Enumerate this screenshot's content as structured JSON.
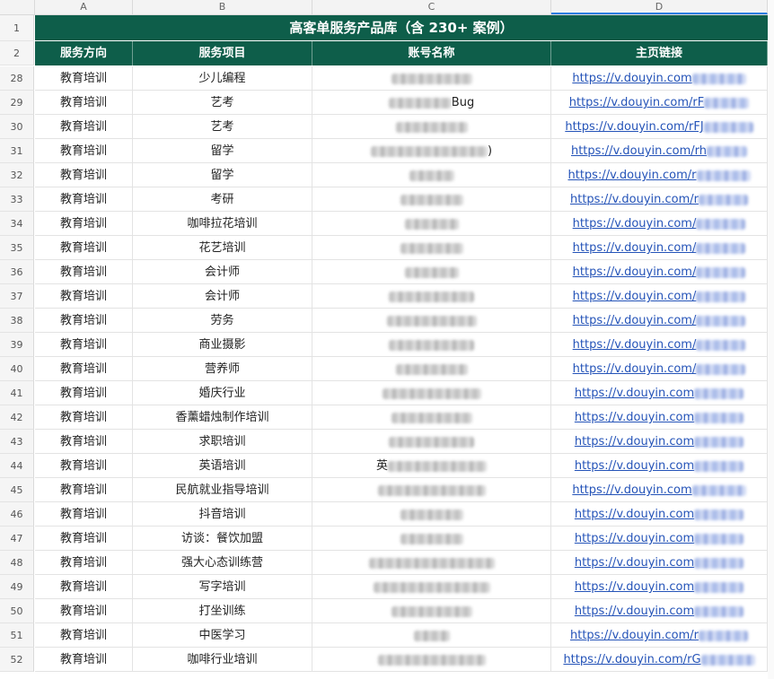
{
  "columns": [
    "A",
    "B",
    "C",
    "D"
  ],
  "title": "高客单服务产品库（含 230+ 案例）",
  "headers": [
    "服务方向",
    "服务项目",
    "账号名称",
    "主页链接"
  ],
  "rows": [
    {
      "n": "28",
      "dir": "教育培训",
      "item": "少儿编程",
      "acct": "",
      "link": "https://v.douyin.com"
    },
    {
      "n": "29",
      "dir": "教育培训",
      "item": "艺考",
      "acct": "Bug",
      "link": "https://v.douyin.com/rF"
    },
    {
      "n": "30",
      "dir": "教育培训",
      "item": "艺考",
      "acct": "",
      "link": "https://v.douyin.com/rFJ"
    },
    {
      "n": "31",
      "dir": "教育培训",
      "item": "留学",
      "acct": ")",
      "link": "https://v.douyin.com/rh"
    },
    {
      "n": "32",
      "dir": "教育培训",
      "item": "留学",
      "acct": "",
      "link": "https://v.douyin.com/r"
    },
    {
      "n": "33",
      "dir": "教育培训",
      "item": "考研",
      "acct": "",
      "link": "https://v.douyin.com/r"
    },
    {
      "n": "34",
      "dir": "教育培训",
      "item": "咖啡拉花培训",
      "acct": "",
      "link": "https://v.douyin.com/"
    },
    {
      "n": "35",
      "dir": "教育培训",
      "item": "花艺培训",
      "acct": "",
      "link": "https://v.douyin.com/"
    },
    {
      "n": "36",
      "dir": "教育培训",
      "item": "会计师",
      "acct": "",
      "link": "https://v.douyin.com/"
    },
    {
      "n": "37",
      "dir": "教育培训",
      "item": "会计师",
      "acct": "",
      "link": "https://v.douyin.com/"
    },
    {
      "n": "38",
      "dir": "教育培训",
      "item": "劳务",
      "acct": "",
      "link": "https://v.douyin.com/"
    },
    {
      "n": "39",
      "dir": "教育培训",
      "item": "商业摄影",
      "acct": "",
      "link": "https://v.douyin.com/"
    },
    {
      "n": "40",
      "dir": "教育培训",
      "item": "营养师",
      "acct": "",
      "link": "https://v.douyin.com/"
    },
    {
      "n": "41",
      "dir": "教育培训",
      "item": "婚庆行业",
      "acct": "",
      "link": "https://v.douyin.com"
    },
    {
      "n": "42",
      "dir": "教育培训",
      "item": "香薰蜡烛制作培训",
      "acct": "",
      "link": "https://v.douyin.com"
    },
    {
      "n": "43",
      "dir": "教育培训",
      "item": "求职培训",
      "acct": "",
      "link": "https://v.douyin.com"
    },
    {
      "n": "44",
      "dir": "教育培训",
      "item": "英语培训",
      "acct": "英",
      "link": "https://v.douyin.com"
    },
    {
      "n": "45",
      "dir": "教育培训",
      "item": "民航就业指导培训",
      "acct": "",
      "link": "https://v.douyin.com"
    },
    {
      "n": "46",
      "dir": "教育培训",
      "item": "抖音培训",
      "acct": "",
      "link": "https://v.douyin.com"
    },
    {
      "n": "47",
      "dir": "教育培训",
      "item": "访谈：餐饮加盟",
      "acct": "",
      "link": "https://v.douyin.com"
    },
    {
      "n": "48",
      "dir": "教育培训",
      "item": "强大心态训练营",
      "acct": "",
      "link": "https://v.douyin.com"
    },
    {
      "n": "49",
      "dir": "教育培训",
      "item": "写字培训",
      "acct": "",
      "link": "https://v.douyin.com"
    },
    {
      "n": "50",
      "dir": "教育培训",
      "item": "打坐训练",
      "acct": "",
      "link": "https://v.douyin.com"
    },
    {
      "n": "51",
      "dir": "教育培训",
      "item": "中医学习",
      "acct": "",
      "link": "https://v.douyin.com/r"
    },
    {
      "n": "52",
      "dir": "教育培训",
      "item": "咖啡行业培训",
      "acct": "",
      "link": "https://v.douyin.com/rG"
    }
  ],
  "colors": {
    "header_bg": "#0e5e4a",
    "link": "#2453b8"
  }
}
